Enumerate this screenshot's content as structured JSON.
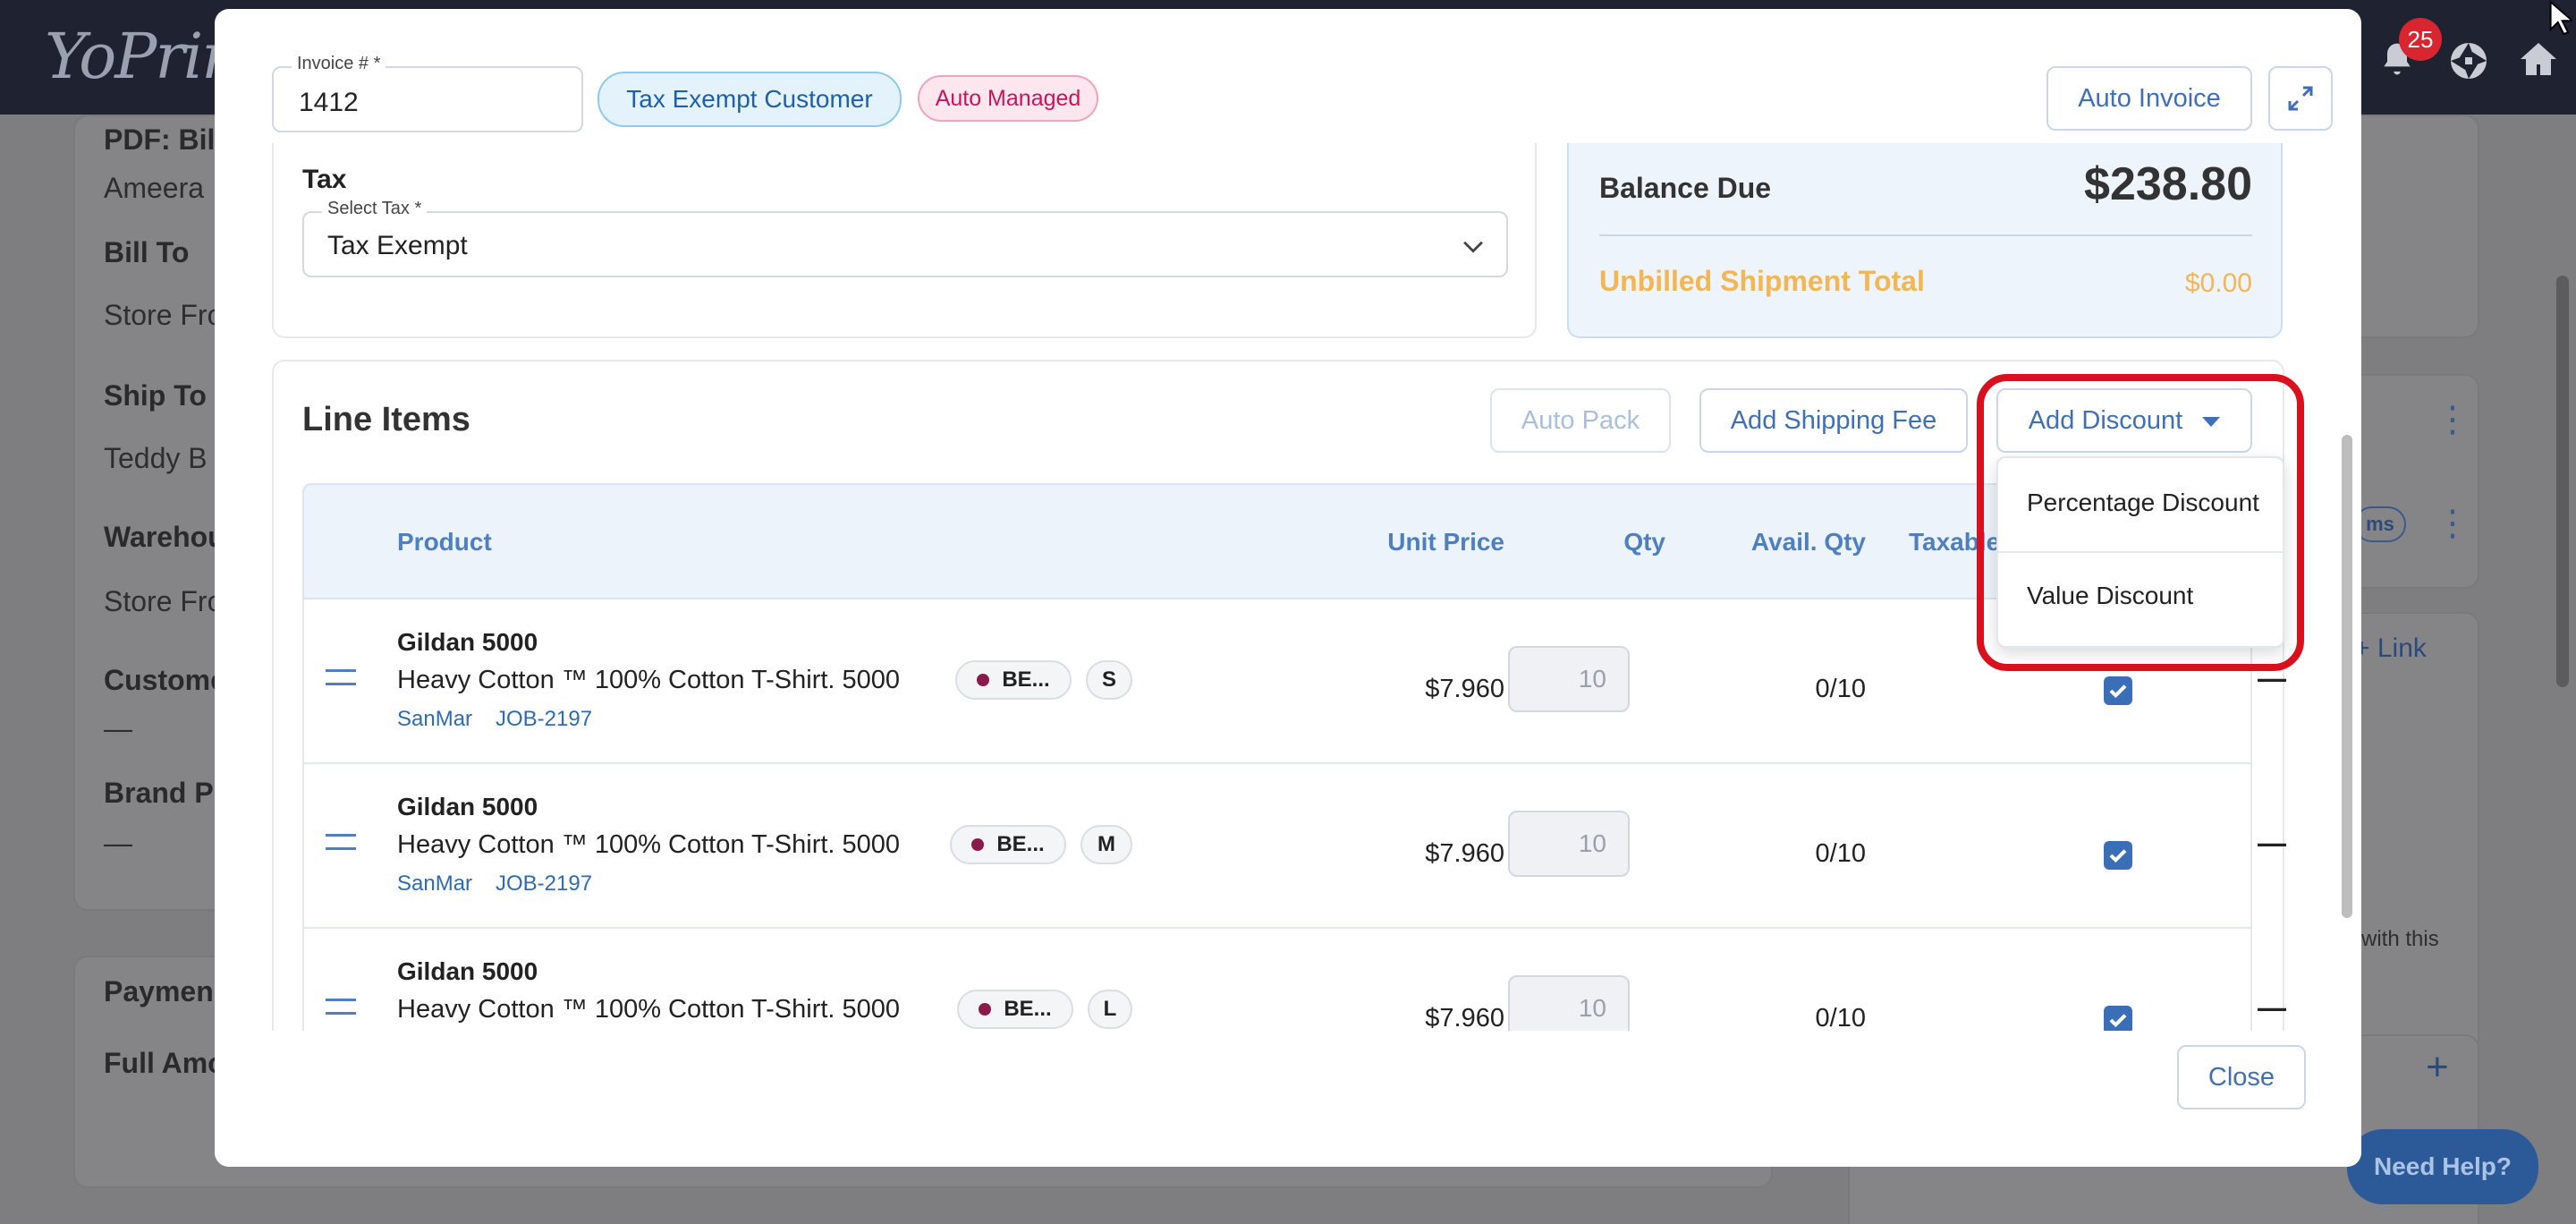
{
  "topbar": {
    "logo": "YoPrint",
    "notifications_count": "25"
  },
  "background": {
    "labels": [
      "PDF: Bill",
      "Ameera",
      "Bill To",
      "Store Fro",
      "Ship To",
      "Teddy B",
      "Warehou",
      "Store Fro",
      "Custome",
      "—",
      "Brand Pr",
      "—",
      "Paymen",
      "Full Amo"
    ],
    "right_tag": "ms",
    "right_link": "Link",
    "right_text": "with this",
    "help": "Need Help?"
  },
  "modal": {
    "invoice_label": "Invoice # *",
    "invoice_value": "1412",
    "tax_exempt_badge": "Tax Exempt Customer",
    "auto_managed_badge": "Auto Managed",
    "auto_invoice_button": "Auto Invoice",
    "tax_section_title": "Tax",
    "select_tax_label": "Select Tax *",
    "select_tax_value": "Tax Exempt",
    "balance_due_label": "Balance Due",
    "balance_due_value": "$238.80",
    "unbilled_label": "Unbilled Shipment Total",
    "unbilled_value": "$0.00",
    "line_items_title": "Line Items",
    "auto_pack_button": "Auto Pack",
    "add_shipping_button": "Add Shipping Fee",
    "add_discount_button": "Add Discount",
    "discount_menu": [
      "Percentage Discount",
      "Value Discount"
    ],
    "columns": {
      "product": "Product",
      "unit_price": "Unit Price",
      "qty": "Qty",
      "avail_qty": "Avail. Qty",
      "taxable": "Taxable"
    },
    "rows": [
      {
        "title": "Gildan 5000",
        "desc": "Heavy Cotton ™ 100% Cotton T-Shirt. 5000",
        "vendor": "SanMar",
        "job": "JOB-2197",
        "color": "BE...",
        "size": "S",
        "price": "$7.960",
        "qty": "10",
        "avail": "0/10",
        "dash": "—"
      },
      {
        "title": "Gildan 5000",
        "desc": "Heavy Cotton ™ 100% Cotton T-Shirt. 5000",
        "vendor": "SanMar",
        "job": "JOB-2197",
        "color": "BE...",
        "size": "M",
        "price": "$7.960",
        "qty": "10",
        "avail": "0/10",
        "dash": "—"
      },
      {
        "title": "Gildan 5000",
        "desc": "Heavy Cotton ™ 100% Cotton T-Shirt. 5000",
        "vendor": "",
        "job": "",
        "color": "BE...",
        "size": "L",
        "price": "$7.960",
        "qty": "10",
        "avail": "0/10",
        "dash": "—"
      }
    ],
    "close_button": "Close"
  },
  "colors": {
    "accent": "#3f6fb5",
    "highlight_ring": "#d9111e",
    "unbilled": "#f2b654",
    "auto_managed": "#c2185b"
  }
}
